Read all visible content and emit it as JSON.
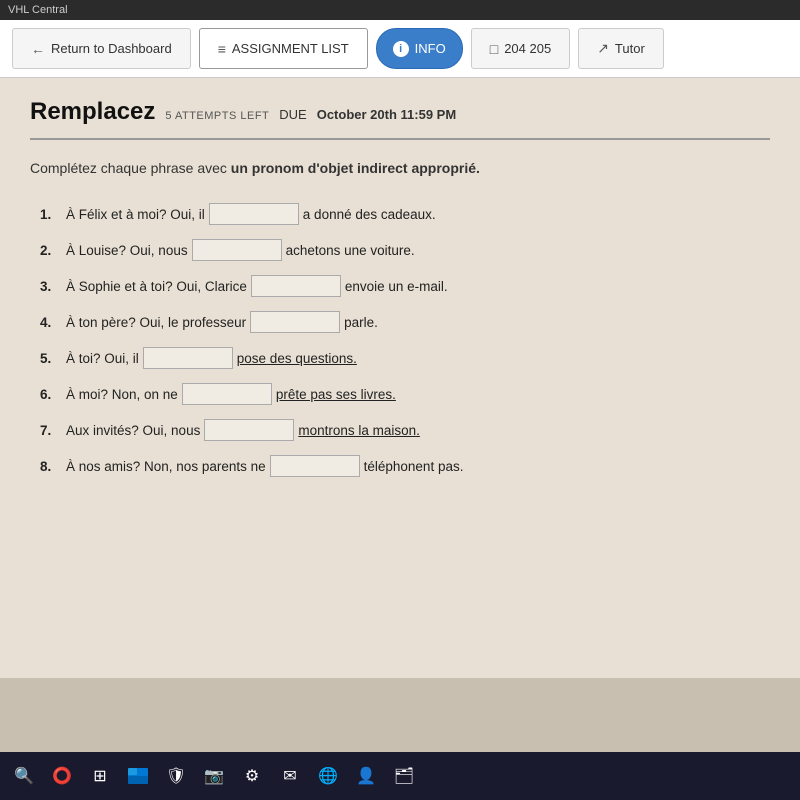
{
  "titleBar": {
    "label": "VHL Central"
  },
  "navBar": {
    "returnBtn": "Return to Dashboard",
    "assignmentBtn": "ASSIGNMENT LIST",
    "infoBtn": "INFO",
    "pagesBtn": "204 205",
    "tutorBtn": "Tutor"
  },
  "assignment": {
    "title": "Remplacez",
    "attemptsLeft": "5 ATTEMPTS LEFT",
    "dueLabel": "DUE",
    "dueDate": "October 20th 11:59 PM",
    "instruction": "Complétez chaque phrase avec un pronom d'objet indirect approprié.",
    "instructionBold": "un pronom d'objet indirect approprié."
  },
  "questions": [
    {
      "number": "1.",
      "before": "À Félix et à moi? Oui, il",
      "after": "a donné des cadeaux.",
      "underline": false
    },
    {
      "number": "2.",
      "before": "À Louise? Oui, nous",
      "after": "achetons une voiture.",
      "underline": false
    },
    {
      "number": "3.",
      "before": "À Sophie et à toi? Oui, Clarice",
      "after": "envoie un e-mail.",
      "underline": false
    },
    {
      "number": "4.",
      "before": "À ton père? Oui, le professeur",
      "after": "parle.",
      "underline": false
    },
    {
      "number": "5.",
      "before": "À toi? Oui, il",
      "after": "pose des questions.",
      "underline": true
    },
    {
      "number": "6.",
      "before": "À moi? Non, on ne",
      "after": "prête pas ses livres.",
      "underline": true
    },
    {
      "number": "7.",
      "before": "Aux invités? Oui, nous",
      "after": "montrons la maison.",
      "underline": true
    },
    {
      "number": "8.",
      "before": "À nos amis? Non, nos parents ne",
      "after": "téléphonent pas.",
      "underline": false
    }
  ],
  "taskbar": {
    "icons": [
      "🔍",
      "⭕",
      "⊞",
      "🛡",
      "📷",
      "⚙",
      "✉",
      "🌐",
      "👤",
      "🗂"
    ]
  }
}
